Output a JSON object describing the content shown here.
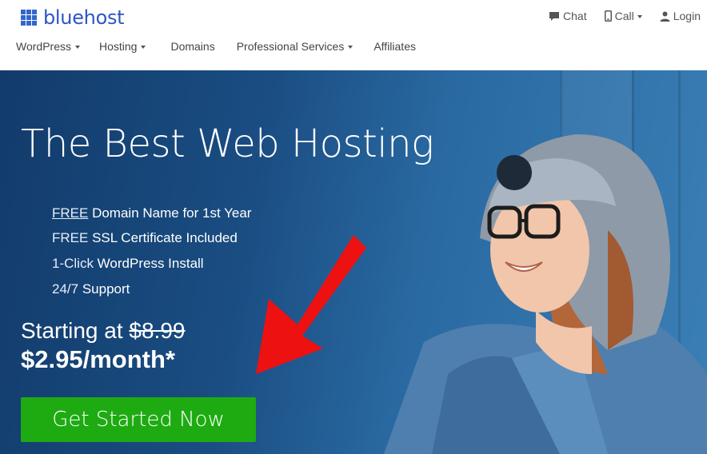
{
  "brand": {
    "name": "bluehost",
    "color": "#2b56c4"
  },
  "utility_nav": {
    "chat": {
      "label": "Chat",
      "icon": "chat-bubble-icon"
    },
    "call": {
      "label": "Call",
      "icon": "phone-icon"
    },
    "login": {
      "label": "Login",
      "icon": "user-icon"
    }
  },
  "main_nav": [
    {
      "label": "WordPress",
      "dropdown": true
    },
    {
      "label": "Hosting",
      "dropdown": true
    },
    {
      "label": "Domains",
      "dropdown": false
    },
    {
      "label": "Professional Services",
      "dropdown": true
    },
    {
      "label": "Affiliates",
      "dropdown": false
    }
  ],
  "hero": {
    "title": "The Best Web Hosting",
    "features": [
      {
        "light": "FREE",
        "bold": " Domain Name for 1st Year"
      },
      {
        "light": "FREE",
        "bold": " SSL Certificate Included"
      },
      {
        "light": "1-Click",
        "bold": " WordPress Install"
      },
      {
        "light": "24/7",
        "bold": " Support"
      }
    ],
    "starting_prefix": "Starting at ",
    "old_price": "$8.99",
    "price": "$2.95/month*",
    "cta_label": "Get Started Now"
  },
  "colors": {
    "hero_bg": "#1a4d82",
    "cta_bg": "#1eab12",
    "arrow": "#ee1111"
  }
}
